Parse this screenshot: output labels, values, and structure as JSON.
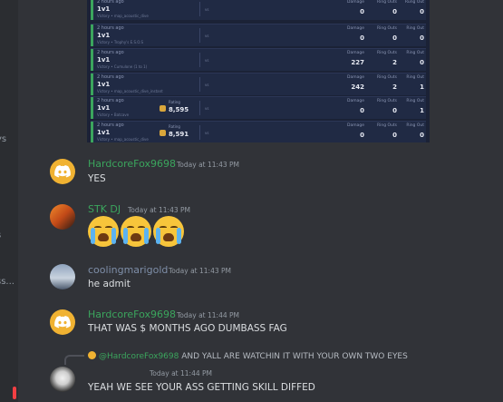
{
  "sidebar_fragments": [
    "ys",
    "s",
    "ss..."
  ],
  "embed": {
    "rows": [
      {
        "time": "2 hours ago",
        "mode": "1v1",
        "sub": "Victory • map_acoustic_dive",
        "vs": "vs",
        "damage_label": "Damage",
        "damage": "0",
        "ringouts_label": "Ring Outs",
        "ringouts": "0",
        "ringout_label": "Rung Out",
        "ringout": "0",
        "rating_label": "",
        "rating": ""
      },
      {
        "time": "2 hours ago",
        "mode": "1v1",
        "sub": "Victory • Trophy's E.S.O.S",
        "vs": "vs",
        "damage_label": "Damage",
        "damage": "0",
        "ringouts_label": "Ring Outs",
        "ringouts": "0",
        "ringout_label": "Ring Out",
        "ringout": "0",
        "rating_label": "",
        "rating": ""
      },
      {
        "time": "2 hours ago",
        "mode": "1v1",
        "sub": "Victory • Cumulone (1 to 1)",
        "vs": "vs",
        "damage_label": "Damage",
        "damage": "227",
        "ringouts_label": "Ring Outs",
        "ringouts": "2",
        "ringout_label": "Ring Out",
        "ringout": "0",
        "rating_label": "",
        "rating": ""
      },
      {
        "time": "2 hours ago",
        "mode": "1v1",
        "sub": "Victory • map_acoustic_dive_instant",
        "vs": "vs",
        "damage_label": "Damage",
        "damage": "242",
        "ringouts_label": "Ring Outs",
        "ringouts": "2",
        "ringout_label": "Ring Out",
        "ringout": "1",
        "rating_label": "",
        "rating": ""
      },
      {
        "time": "2 hours ago",
        "mode": "1v1",
        "sub": "Victory • Batcave",
        "vs": "vs",
        "damage_label": "Damage",
        "damage": "0",
        "ringouts_label": "Ring Outs",
        "ringouts": "0",
        "ringout_label": "Ring Out",
        "ringout": "1",
        "rating_label": "Rating",
        "rating": "8,595"
      },
      {
        "time": "2 hours ago",
        "mode": "1v1",
        "sub": "Victory • map_acoustic_dive",
        "vs": "vs",
        "damage_label": "Damage",
        "damage": "0",
        "ringouts_label": "Ring Outs",
        "ringouts": "0",
        "ringout_label": "Ring Out",
        "ringout": "0",
        "rating_label": "Rating",
        "rating": "8,591"
      }
    ]
  },
  "messages": [
    {
      "author": "HardcoreFox9698",
      "author_color": "#3ba55d",
      "timestamp": "Today at 11:43 PM",
      "text": "YES"
    },
    {
      "author": "STK DJ",
      "author_color": "#3ba55d",
      "timestamp": "Today at 11:43 PM",
      "text": ""
    },
    {
      "author": "coolingmarigold",
      "author_color": "#7e8ea8",
      "timestamp": "Today at 11:43 PM",
      "text": "he admit"
    },
    {
      "author": "HardcoreFox9698",
      "author_color": "#3ba55d",
      "timestamp": "Today at 11:44 PM",
      "text": "THAT WAS $ MONTHS AGO DUMBASS FAG"
    },
    {
      "author": "",
      "author_color": "#4e6fb8",
      "timestamp": "Today at 11:44 PM",
      "text": "YEAH WE SEE YOUR ASS GETTING SKILL DIFFED"
    }
  ],
  "reply": {
    "mention": "@HardcoreFox9698",
    "text": "AND YALL ARE WATCHIN IT WITH YOUR OWN TWO EYES"
  },
  "emoji": {
    "name": "loudly-crying-face",
    "count": 3
  }
}
